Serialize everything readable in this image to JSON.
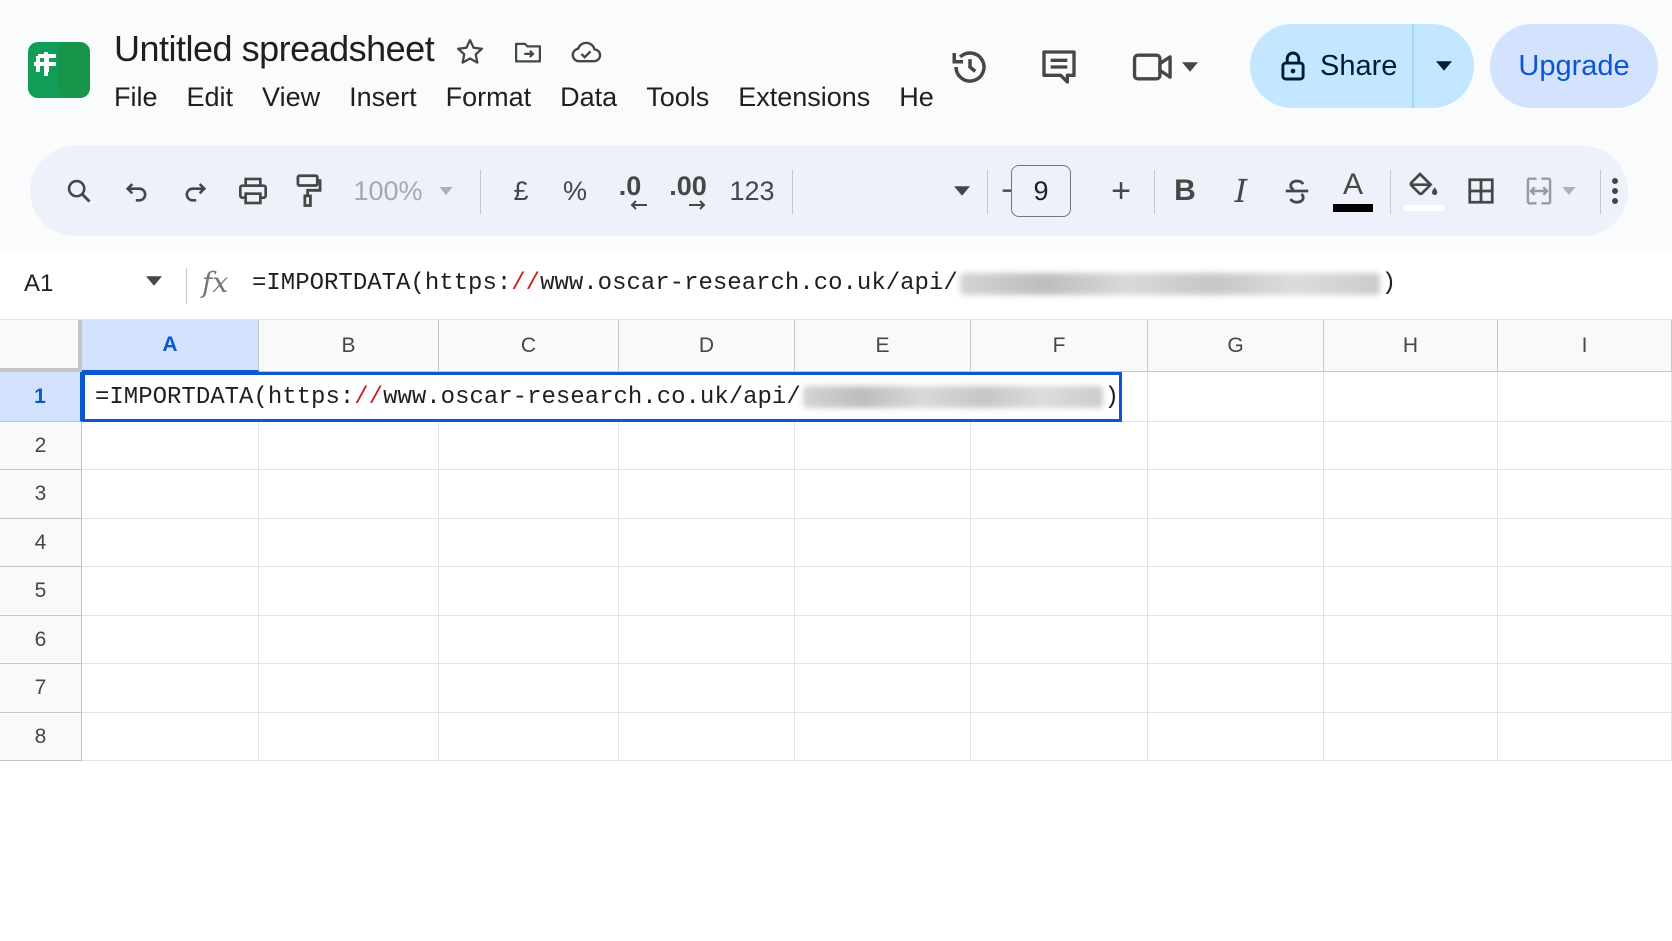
{
  "app": {
    "title": "Untitled spreadsheet",
    "brand_color": "#0f9d58"
  },
  "menu": [
    "File",
    "Edit",
    "View",
    "Insert",
    "Format",
    "Data",
    "Tools",
    "Extensions",
    "He"
  ],
  "header_actions": {
    "share_label": "Share",
    "upgrade_label": "Upgrade",
    "icons": [
      "version-history-icon",
      "comments-icon",
      "meet-icon"
    ]
  },
  "toolbar": {
    "zoom": "100%",
    "currency": "£",
    "percent": "%",
    "decrease_decimal": ".0",
    "increase_decimal": ".00",
    "number_format": "123",
    "font_size": "9",
    "bold": "B",
    "italic": "I",
    "text_color": "A",
    "minus": "−",
    "plus": "+"
  },
  "formula_bar": {
    "name_box": "A1",
    "fx": "fx",
    "formula_prefix": "=IMPORTDATA(https:",
    "formula_slashes": "//",
    "formula_rest": "www.oscar-research.co.uk/api/",
    "formula_close": ")"
  },
  "grid": {
    "columns": [
      "A",
      "B",
      "C",
      "D",
      "E",
      "F",
      "G",
      "H",
      "I"
    ],
    "rows": [
      "1",
      "2",
      "3",
      "4",
      "5",
      "6",
      "7",
      "8"
    ],
    "active_column": "A",
    "active_row": "1",
    "active_cell_prefix": "=IMPORTDATA(https:",
    "active_cell_slashes": "//",
    "active_cell_rest": "www.oscar-research.co.uk/api/",
    "active_cell_close": ")"
  },
  "colors": {
    "selection": "#0b57d0",
    "share_bg": "#c2e7ff",
    "upgrade_bg": "#d3e3fd",
    "toolbar_bg": "#edf2fa"
  }
}
